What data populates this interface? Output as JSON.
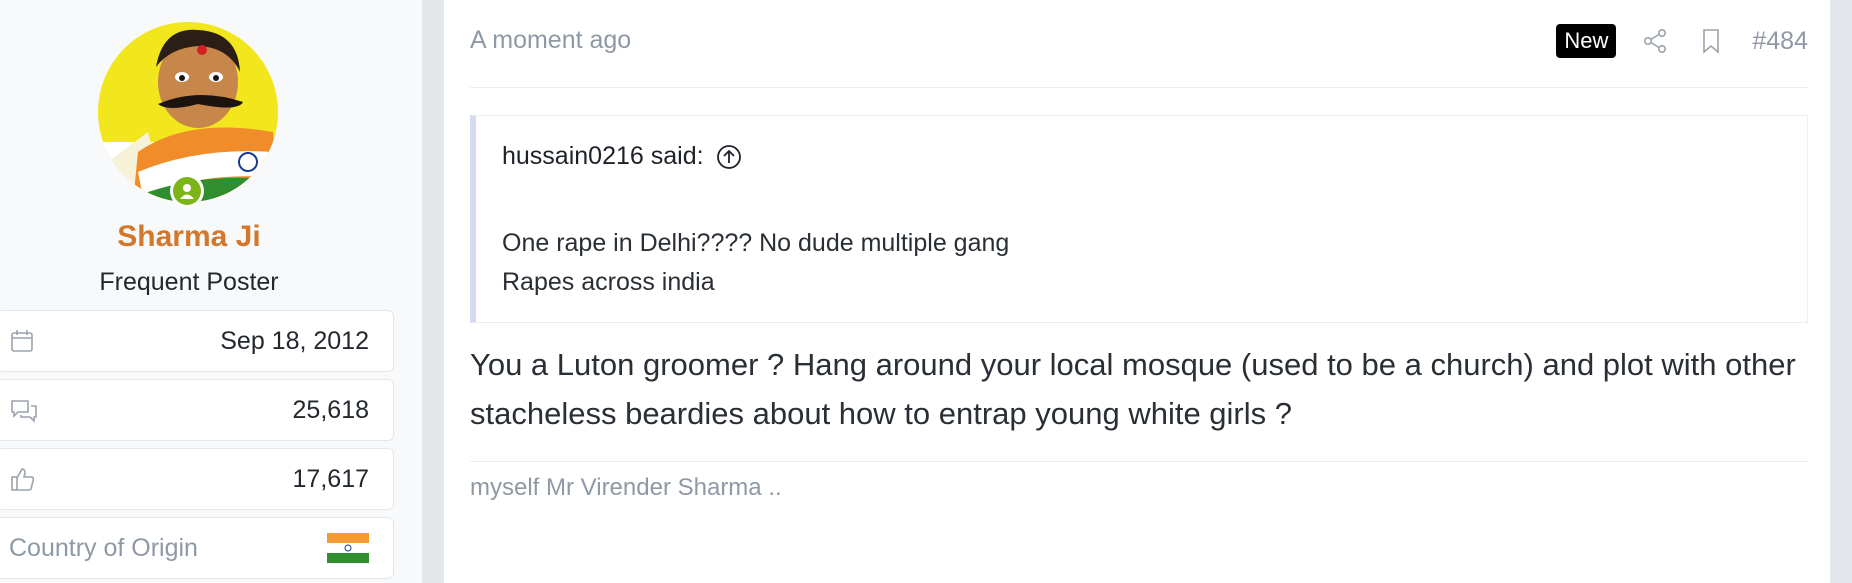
{
  "user": {
    "name": "Sharma Ji",
    "title": "Frequent Poster",
    "name_color": "#d2772c",
    "online_color": "#7cb518"
  },
  "stats": {
    "joined": "Sep 18, 2012",
    "messages": "25,618",
    "reactions": "17,617",
    "country_label": "Country of Origin",
    "country_flag": "india-flag-icon"
  },
  "post": {
    "time": "A moment ago",
    "new_badge": "New",
    "number": "#484",
    "body": "You a Luton groomer ? Hang around your local mosque (used to be a church) and plot with other stacheless beardies about how to entrap young white girls ?",
    "signature": "myself Mr Virender Sharma .."
  },
  "quote": {
    "author": "hussain0216 said:",
    "line1": "One rape in Delhi???? No dude multiple gang",
    "line2": "Rapes across india"
  },
  "icons": {
    "joined": "calendar-icon",
    "messages": "speech-bubbles-icon",
    "reactions": "thumbs-up-icon",
    "share": "share-icon",
    "bookmark": "bookmark-icon",
    "quote_jump": "arrow-up-circle-icon",
    "online": "online-user-icon"
  }
}
